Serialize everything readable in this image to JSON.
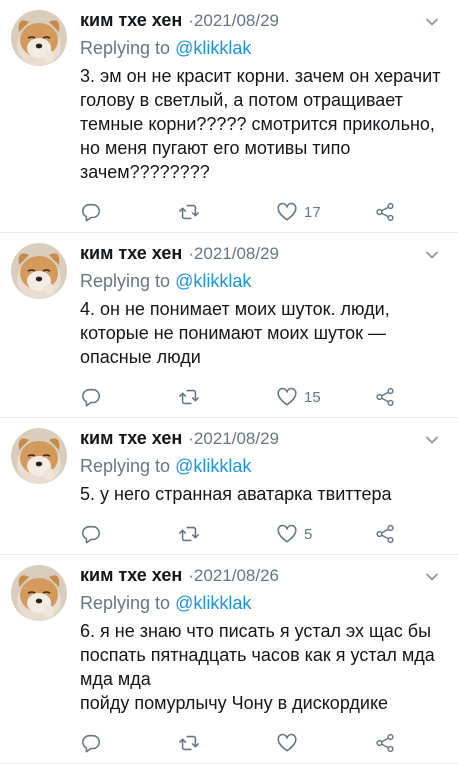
{
  "reply_prefix": "Replying to",
  "tweets": [
    {
      "author": "ким тхе хен",
      "separator": "·",
      "date": "2021/08/29",
      "reply_to": "@klikklak",
      "text": "3. эм он не красит корни. зачем он херачит голову в светлый, а потом отращивает темные корни????? смотрится прикольно, но меня пугают его мотивы типо зачем????????",
      "likes": "17"
    },
    {
      "author": "ким тхе хен",
      "separator": "·",
      "date": "2021/08/29",
      "reply_to": "@klikklak",
      "text": "4. он не понимает моих шуток. люди, которые не понимают моих шуток — опасные люди",
      "likes": "15"
    },
    {
      "author": "ким тхе хен",
      "separator": "·",
      "date": "2021/08/29",
      "reply_to": "@klikklak",
      "text": "5. у него странная аватарка твиттера",
      "likes": "5"
    },
    {
      "author": "ким тхе хен",
      "separator": "·",
      "date": "2021/08/26",
      "reply_to": "@klikklak",
      "text": "6. я не знаю что писать я устал эх щас бы поспать пятнадцать часов как я устал мда мда мда\nпойду помурлычу Чону в дискордике",
      "likes": ""
    }
  ],
  "icons": {
    "reply": "reply-icon",
    "retweet": "retweet-icon",
    "like": "heart-icon",
    "share": "share-icon",
    "menu": "chevron-down-icon"
  },
  "colors": {
    "text": "#14171a",
    "muted": "#657786",
    "link": "#1b95e0",
    "divider": "#e6ecf0"
  }
}
